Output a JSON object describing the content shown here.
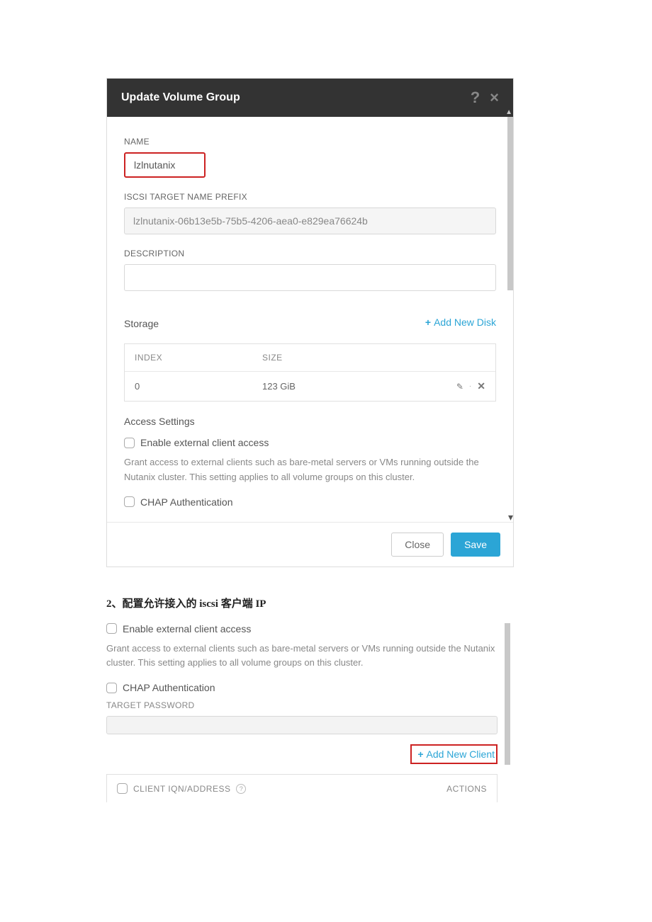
{
  "modal": {
    "title": "Update Volume Group",
    "name_label": "NAME",
    "name_value": "lzlnutanix",
    "iscsi_label": "ISCSI TARGET NAME PREFIX",
    "iscsi_value": "lzlnutanix-06b13e5b-75b5-4206-aea0-e829ea76624b",
    "description_label": "DESCRIPTION",
    "description_value": "",
    "storage_title": "Storage",
    "add_disk": "Add New Disk",
    "table": {
      "col_index": "INDEX",
      "col_size": "SIZE",
      "rows": [
        {
          "index": "0",
          "size": "123 GiB"
        }
      ]
    },
    "access_title": "Access Settings",
    "enable_external_label": "Enable external client access",
    "help_text": "Grant access to external clients such as bare-metal servers or VMs running outside the Nutanix cluster. This setting applies to all volume groups on this cluster.",
    "chap_label": "CHAP Authentication",
    "footer": {
      "close": "Close",
      "save": "Save"
    }
  },
  "step2": {
    "heading_prefix": "2、配置允许接入的 ",
    "heading_iscsi": "iscsi",
    "heading_mid": " 客户端 ",
    "heading_ip": "IP",
    "enable_external_label": "Enable external client access",
    "help_text": "Grant access to external clients such as bare-metal servers or VMs running outside the Nutanix cluster. This setting applies to all volume groups on this cluster.",
    "chap_label": "CHAP Authentication",
    "target_password_label": "TARGET PASSWORD",
    "add_client": "Add New Client",
    "client_header": "CLIENT IQN/ADDRESS",
    "actions_header": "ACTIONS"
  }
}
